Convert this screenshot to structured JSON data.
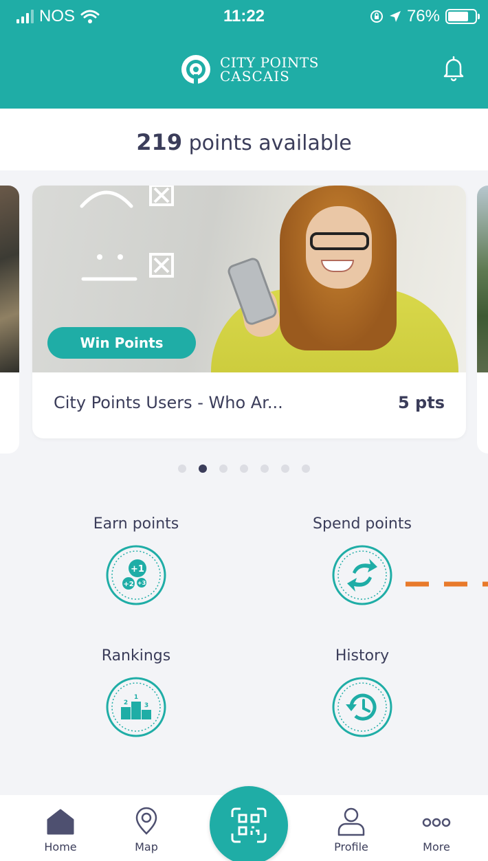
{
  "status_bar": {
    "carrier": "NOS",
    "time": "11:22",
    "battery_percent": "76%",
    "battery_level": 0.76,
    "icons": [
      "signal-icon",
      "wifi-icon",
      "rotation-lock-icon",
      "location-arrow-icon",
      "battery-icon"
    ]
  },
  "header": {
    "logo_line1": "CITY POINTS",
    "logo_line2": "CASCAIS",
    "notification_icon": "bell-icon"
  },
  "points": {
    "value": "219",
    "suffix": "points available"
  },
  "carousel": {
    "card": {
      "badge": "Win Points",
      "title": "City Points Users - Who Ar...",
      "points": "5 pts"
    },
    "page_count": 7,
    "active_index": 1
  },
  "actions": [
    {
      "label": "Earn points",
      "icon": "earn-points-icon"
    },
    {
      "label": "Spend points",
      "icon": "spend-points-icon"
    },
    {
      "label": "Rankings",
      "icon": "rankings-podium-icon"
    },
    {
      "label": "History",
      "icon": "history-clock-icon"
    }
  ],
  "tabbar": {
    "tabs": [
      {
        "label": "Home",
        "icon": "home-icon",
        "active": true
      },
      {
        "label": "Map",
        "icon": "map-pin-icon",
        "active": false
      },
      {
        "label": "Profile",
        "icon": "profile-icon",
        "active": false
      },
      {
        "label": "More",
        "icon": "more-icon",
        "active": false
      }
    ],
    "center_icon": "qr-scan-icon"
  },
  "colors": {
    "brand": "#1fada6",
    "text": "#3b3d5a",
    "annotation_arrow": "#e87a2b",
    "background": "#f3f4f7"
  }
}
